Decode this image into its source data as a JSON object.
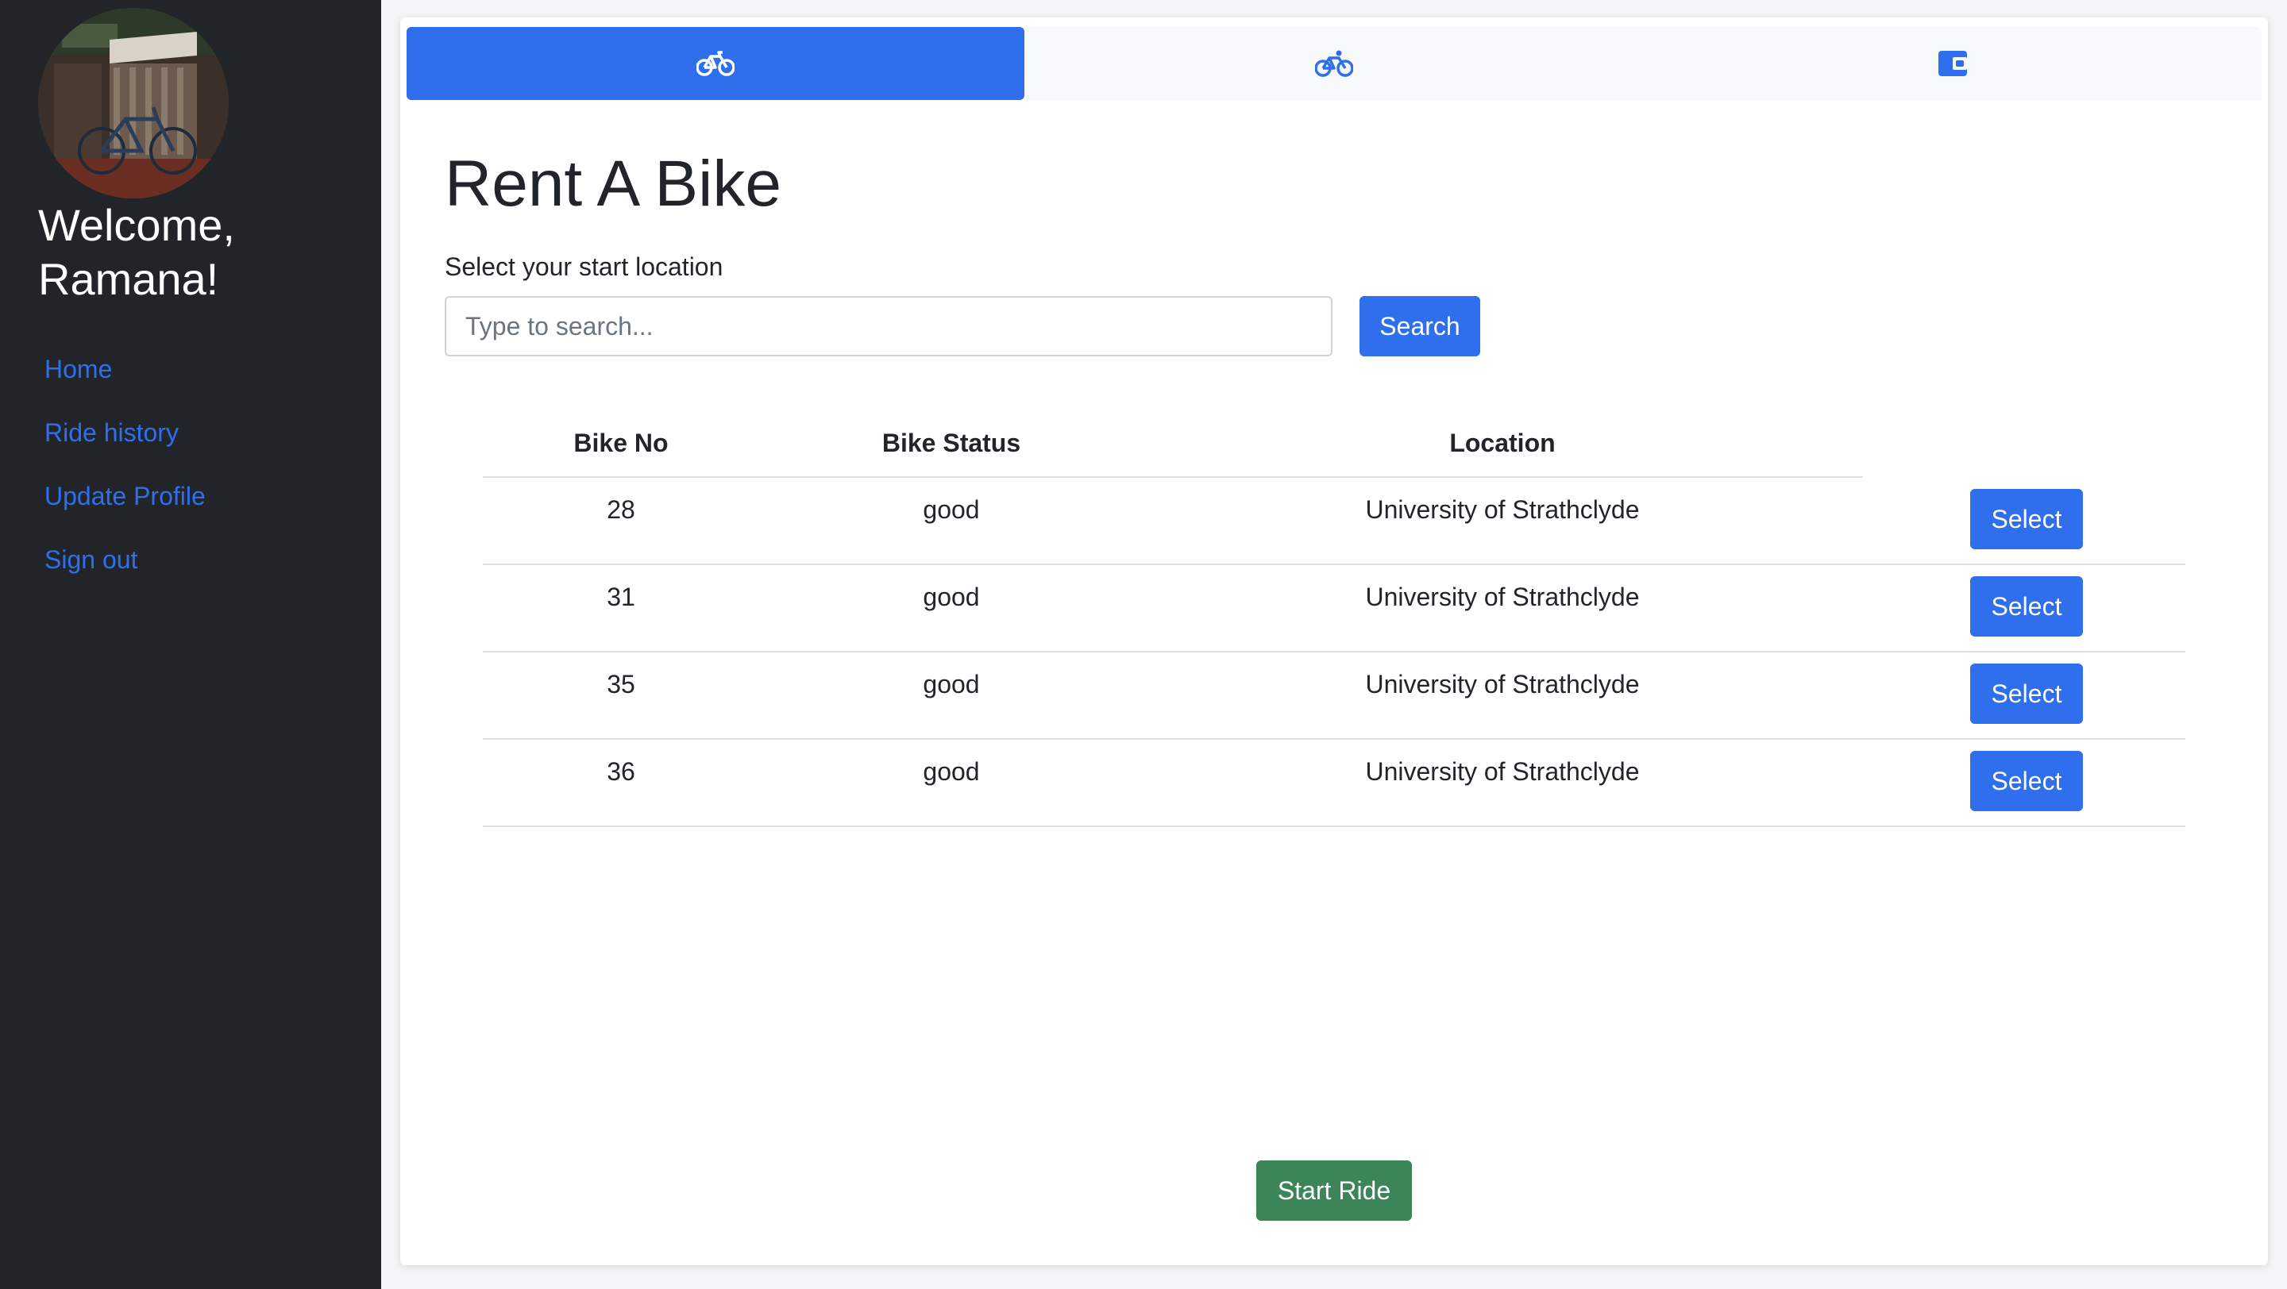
{
  "sidebar": {
    "welcome": "Welcome, Ramana!",
    "nav": [
      {
        "label": "Home"
      },
      {
        "label": "Ride history"
      },
      {
        "label": "Update Profile"
      },
      {
        "label": "Sign out"
      }
    ]
  },
  "tabs": [
    {
      "icon": "bicycle-icon",
      "active": true
    },
    {
      "icon": "bicycle-rider-icon",
      "active": false
    },
    {
      "icon": "wallet-icon",
      "active": false
    }
  ],
  "main": {
    "title": "Rent A Bike",
    "subtitle": "Select your start location",
    "search": {
      "placeholder": "Type to search...",
      "button": "Search"
    },
    "table": {
      "headers": [
        "Bike No",
        "Bike Status",
        "Location"
      ],
      "rows": [
        {
          "bike_no": "28",
          "status": "good",
          "location": "University of Strathclyde",
          "action": "Select"
        },
        {
          "bike_no": "31",
          "status": "good",
          "location": "University of Strathclyde",
          "action": "Select"
        },
        {
          "bike_no": "35",
          "status": "good",
          "location": "University of Strathclyde",
          "action": "Select"
        },
        {
          "bike_no": "36",
          "status": "good",
          "location": "University of Strathclyde",
          "action": "Select"
        }
      ]
    },
    "start_button": "Start Ride"
  },
  "colors": {
    "sidebar_bg": "#212529",
    "primary": "#2f6fed",
    "success": "#3b8558",
    "link": "#2f6fed"
  }
}
